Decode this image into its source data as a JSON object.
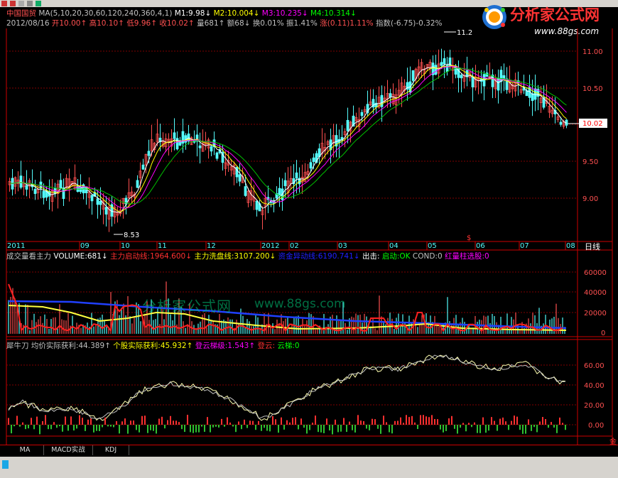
{
  "stock": {
    "name": "中国国贸",
    "ma_line": "MA(5,10,20,30,60,120,240,360,4,1)",
    "m1": "M1:9.98",
    "m2": "M2:10.004",
    "m3": "M3:10.235",
    "m4": "M4:10.314",
    "date": "2012/08/16",
    "open": "开10.00",
    "high": "高10.10",
    "low": "低9.96",
    "close": "收10.02",
    "volume": "量681",
    "amount": "额68",
    "turnover": "换0.01%",
    "amplitude": "振1.41%",
    "change": "涨(0.11)1.11%",
    "index": "指数(-6.75)-0.32%"
  },
  "price_panel": {
    "y_ticks": [
      "11.00",
      "10.50",
      "10.02",
      "9.50",
      "9.00"
    ],
    "current_price": "10.02",
    "high_label": "11.2",
    "low_label": "8.53",
    "x_ticks": [
      "2011",
      "09",
      "10",
      "11",
      "12",
      "2012",
      "02",
      "03",
      "04",
      "05",
      "06",
      "07",
      "08"
    ],
    "period": "日线",
    "colors": {
      "up": "#ff5050",
      "down": "#54fcfc",
      "ma1": "#ffffff",
      "ma2": "#ffff00",
      "ma3": "#ff00ff",
      "ma4": "#00c000"
    }
  },
  "volume_panel": {
    "title": "成交量看主力",
    "vol": "VOLUME:681",
    "l1": "主力启动线:1964.600",
    "l2": "主力洗盘线:3107.200",
    "l3": "资金异动线:6190.741",
    "l4": "出击:",
    "l5": "启动:OK",
    "l6": "COND:0",
    "l7": "红量柱选股:0",
    "y_ticks": [
      "60000",
      "40000",
      "20000",
      "0"
    ]
  },
  "indicator_panel": {
    "title": "犀牛刀",
    "avg": "均价实际获利:44.389",
    "stock": "个股实际获利:45.932",
    "ladder": "登云梯级:1.543",
    "ladder2": "登云:",
    "ladder3": "云梯:0",
    "y_ticks": [
      "60.00",
      "40.00",
      "20.00",
      "0.00"
    ]
  },
  "tabs": [
    "MA",
    "MACD实战",
    "KDJ"
  ],
  "logo": {
    "title": "分析家公式网",
    "url": "www.88gs.com"
  },
  "watermark": {
    "text": "分析家公式网",
    "url": "www.88gs.com"
  }
}
